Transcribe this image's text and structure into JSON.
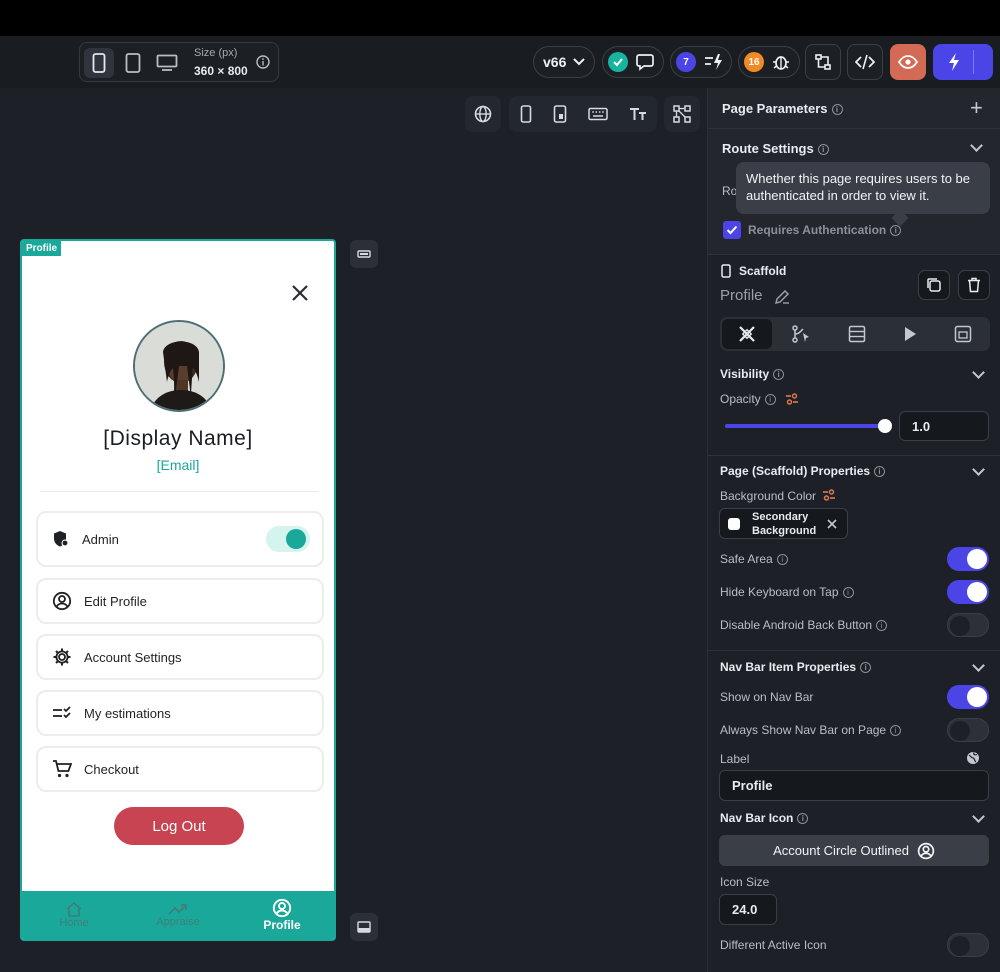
{
  "toolbar": {
    "size_label": "Size (px)",
    "size_value": "360 × 800",
    "version": "v66",
    "badge_issues": "7",
    "badge_bugs": "16"
  },
  "device": {
    "tag": "Profile",
    "display_name": "[Display Name]",
    "email": "[Email]",
    "menu": [
      {
        "label": "Admin",
        "icon": "shield-icon"
      },
      {
        "label": "Edit Profile",
        "icon": "account-circle-icon"
      },
      {
        "label": "Account Settings",
        "icon": "gear-icon"
      },
      {
        "label": "My estimations",
        "icon": "checklist-icon"
      },
      {
        "label": "Checkout",
        "icon": "cart-icon"
      }
    ],
    "logout_label": "Log Out",
    "nav": [
      {
        "label": "Home"
      },
      {
        "label": "Appraise"
      },
      {
        "label": "Profile"
      }
    ]
  },
  "panel": {
    "page_parameters": "Page Parameters",
    "route_settings": "Route Settings",
    "route_partial": "Ro",
    "tooltip": "Whether this page requires users to be authenticated in order to view it.",
    "requires_auth": "Requires Authentication",
    "scaffold": "Scaffold",
    "page_name": "Profile",
    "visibility": "Visibility",
    "opacity": "Opacity",
    "opacity_value": "1.0",
    "opacity_fraction": 1.0,
    "page_props": "Page (Scaffold) Properties",
    "bg_color": "Background Color",
    "bg_color_value_1": "Secondary",
    "bg_color_value_2": "Background",
    "safe_area": "Safe Area",
    "hide_keyboard": "Hide Keyboard on Tap",
    "disable_back": "Disable Android Back Button",
    "navbar_props": "Nav Bar Item Properties",
    "show_navbar": "Show on Nav Bar",
    "always_show": "Always Show Nav Bar on Page",
    "label": "Label",
    "label_value": "Profile",
    "navbar_icon": "Nav Bar Icon",
    "icon_value": "Account Circle Outlined",
    "icon_size": "Icon Size",
    "icon_size_value": "24.0",
    "diff_icon": "Different Active Icon"
  },
  "colors": {
    "accent": "#1aa89a",
    "primary": "#4b45e8",
    "logout": "#c94452"
  }
}
